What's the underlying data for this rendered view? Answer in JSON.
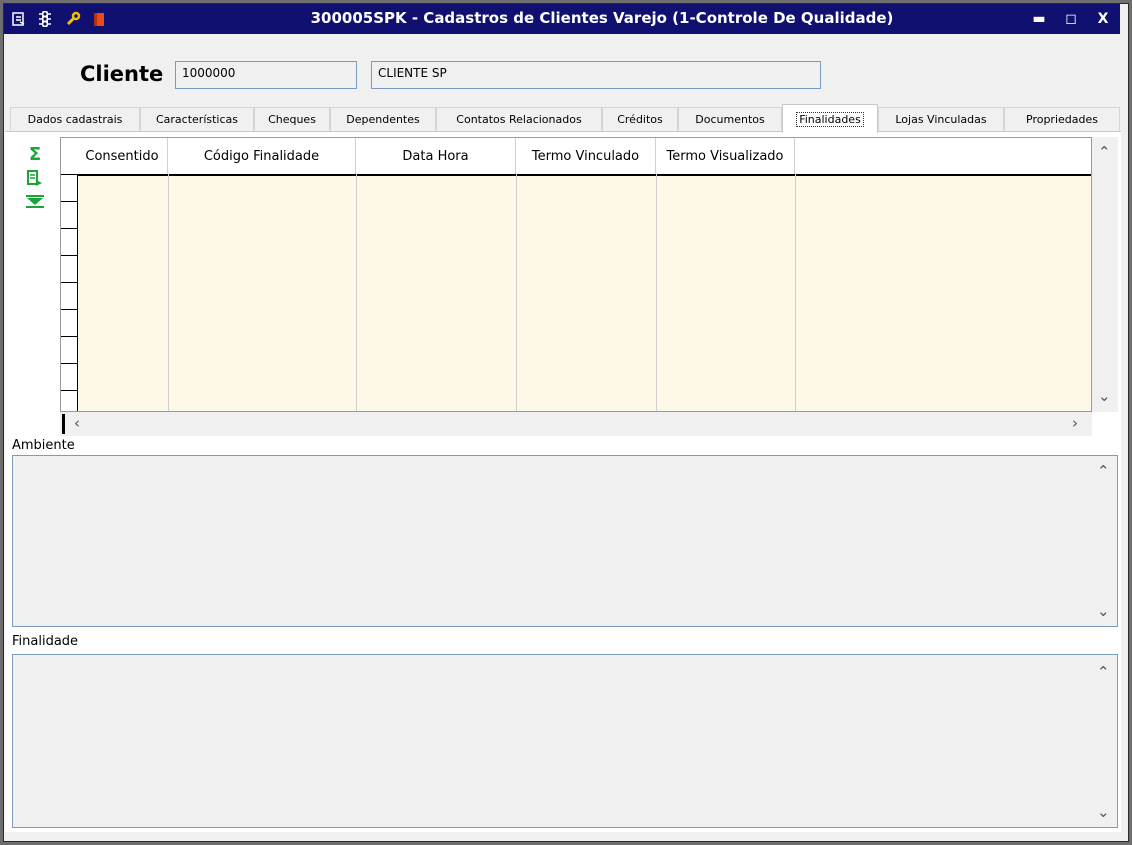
{
  "window": {
    "title": "300005SPK - Cadastros de Clientes Varejo (1-Controle De Qualidade)",
    "titlebar_icons": [
      "form-icon",
      "traffic-light-icon",
      "wrench-icon",
      "book-icon"
    ],
    "controls": {
      "minimize": "▬",
      "maximize": "◻",
      "close": "X"
    }
  },
  "header": {
    "cliente_label": "Cliente",
    "cliente_code": "1000000",
    "cliente_name": "CLIENTE SP"
  },
  "tabs": [
    {
      "label": "Dados cadastrais"
    },
    {
      "label": "Características"
    },
    {
      "label": "Cheques"
    },
    {
      "label": "Dependentes"
    },
    {
      "label": "Contatos Relacionados"
    },
    {
      "label": "Créditos"
    },
    {
      "label": "Documentos"
    },
    {
      "label": "Finalidades",
      "active": true
    },
    {
      "label": "Lojas Vinculadas"
    },
    {
      "label": "Propriedades"
    }
  ],
  "toolbar": {
    "sum_icon": "Σ",
    "export_icon": "⇛",
    "download_icon": "⏬"
  },
  "grid": {
    "columns": [
      "Consentido",
      "Código Finalidade",
      "Data Hora",
      "Termo Vinculado",
      "Termo Visualizado"
    ],
    "rows": []
  },
  "sections": {
    "ambiente_label": "Ambiente",
    "finalidade_label": "Finalidade"
  },
  "colors": {
    "titlebar": "#0f1070",
    "grid_bg": "#fdf8e8",
    "accent_green": "#1aa43a"
  }
}
